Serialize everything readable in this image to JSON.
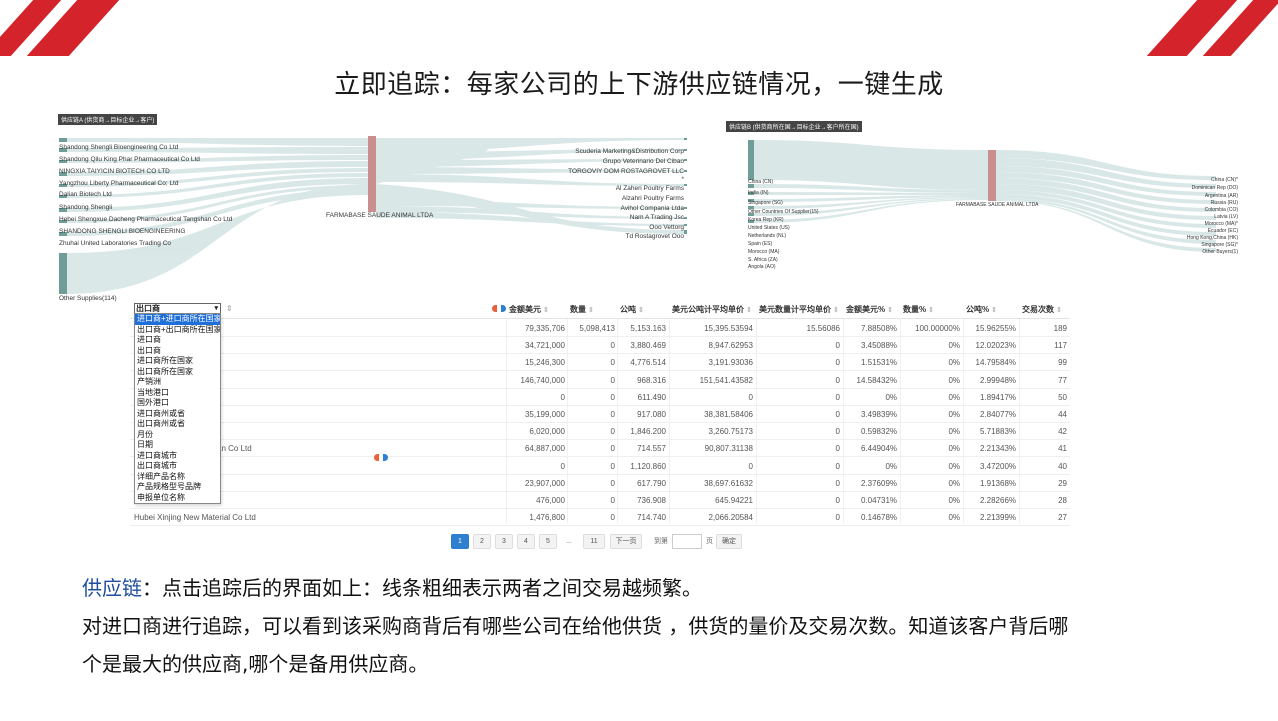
{
  "slide": {
    "title": "立即追踪：每家公司的上下游供应链情况，一键生成",
    "caption_keyword": "供应链",
    "caption_line1_rest": "：点击追踪后的界面如上：线条粗细表示两者之间交易越频繁。",
    "caption_line2": "对进口商进行追踪，可以看到该采购商背后有哪些公司在给他供货 ，供货的量价及交易次数。知道该客户背后哪",
    "caption_line3": "个是最大的供应商,哪个是备用供应商。",
    "accent_color": "#d4232b"
  },
  "sankey_left": {
    "label": "供应链A (供货商→目标企业→客户)",
    "center_node": "FARMABASE SAUDE ANIMAL LTDA",
    "suppliers": [
      "Shandong Shengli Bioengineering Co Ltd",
      "Shandong Qilu King Phar Pharmaceutical Co Ltd",
      "NINGXIA TAIYICIN BIOTECH CO LTD",
      "Yangzhou Liberty Pharmaceutical Co; Ltd",
      "Dalian Biotech Ltd",
      "Shandong Shengli",
      "Hebei Shengxue Dacheng Pharmaceutical Tangshan Co Ltd",
      "SHANDONG SHENGLI BIOENGINEERING",
      "Zhuhai United Laboratories Trading Co",
      "Other Supplies(114)"
    ],
    "customers": [
      "Scuderia Marketing&Distribution Corp",
      "Grupo Veterinario Del Cibao",
      "TORGOVIY DOM ROSTAGROVET LLC",
      "*",
      "Al Zaheri Poultry Farms",
      "Alzahri Poultry Farms",
      "Avihol Compania Ltda",
      "Nam A Trading Jsc",
      "Ooo Vettorg",
      "Td Rostagrovet Ooo"
    ]
  },
  "sankey_right": {
    "label": "供应链B (供货商所在国→目标企业→客户所在国)",
    "center_node": "FARMABASE SAUDE ANIMAL LTDA",
    "origins": [
      "China (CN)",
      "India (IN)",
      "Singapore (SG)",
      "Other Countries Of Supplier(15)",
      "Korea Rep (KR)",
      "United States (US)",
      "Netherlands (NL)",
      "Spain (ES)",
      "Morocco (MA)",
      "S. Africa (ZA)",
      "Angola (AO)"
    ],
    "destinations": [
      "China (CN)*",
      "Dominican Rep (DO)",
      "Argentina (AR)",
      "Russia (RU)",
      "Colombia (CO)",
      "Latvia (LV)",
      "Morocco (MA)*",
      "Ecuador (EC)",
      "Hong Kong,China (HK)",
      "Singapore (SG)*",
      "Other Buyers(1)"
    ]
  },
  "table": {
    "select_value": "出口商",
    "dropdown_options": [
      "进口商+进口商所在国家",
      "出口商+出口商所在国家",
      "进口商",
      "出口商",
      "进口商所在国家",
      "出口商所在国家",
      "产销洲",
      "当地港口",
      "国外港口",
      "进口商州或省",
      "出口商州或省",
      "月份",
      "日期",
      "进口商城市",
      "出口商城市",
      "详细产品名称",
      "产品规格型号品牌",
      "申报单位名称"
    ],
    "columns": [
      "金额美元",
      "数量",
      "公吨",
      "美元公吨计平均单价",
      "美元数量计平均单价",
      "金额美元%",
      "数量%",
      "公吨%",
      "交易次数"
    ],
    "rows": [
      {
        "name": "",
        "c": [
          "79,335,706",
          "5,098,413",
          "5,153.163",
          "15,395.53594",
          "15.56086",
          "7.88508%",
          "100.00000%",
          "15.96255%",
          "189"
        ]
      },
      {
        "name": "ineering Co Ltd",
        "c": [
          "34,721,000",
          "0",
          "3,880.469",
          "8,947.62953",
          "0",
          "3.45088%",
          "0%",
          "12.02023%",
          "117"
        ]
      },
      {
        "name": "Pharmaceutical Co Ltd",
        "c": [
          "15,246,300",
          "0",
          "4,776.514",
          "3,191.93036",
          "0",
          "1.51531%",
          "0%",
          "14.79584%",
          "99"
        ]
      },
      {
        "name": "H CO LTD",
        "c": [
          "146,740,000",
          "0",
          "968.316",
          "151,541.43582",
          "0",
          "14.58432%",
          "0%",
          "2.99948%",
          "77"
        ]
      },
      {
        "name": "eutical Co; Ltd",
        "c": [
          "0",
          "0",
          "611.490",
          "0",
          "0",
          "0%",
          "0%",
          "1.89417%",
          "50"
        ]
      },
      {
        "name": "",
        "c": [
          "35,199,000",
          "0",
          "917.080",
          "38,381.58406",
          "0",
          "3.49839%",
          "0%",
          "2.84077%",
          "44"
        ]
      },
      {
        "name": "",
        "c": [
          "6,020,000",
          "0",
          "1,846.200",
          "3,260.75173",
          "0",
          "0.59832%",
          "0%",
          "5.71883%",
          "42"
        ]
      },
      {
        "name": "Pharmaceutical Tangshan Co Ltd",
        "c": [
          "64,887,000",
          "0",
          "714.557",
          "90,807.31138",
          "0",
          "6.44904%",
          "0%",
          "2.21343%",
          "41"
        ]
      },
      {
        "name": "ENGINEERING",
        "c": [
          "0",
          "0",
          "1,120.860",
          "0",
          "0",
          "0%",
          "0%",
          "3.47200%",
          "40"
        ]
      },
      {
        "name": "s Trading Co",
        "c": [
          "23,907,000",
          "0",
          "617.790",
          "38,697.61632",
          "0",
          "2.37609%",
          "0%",
          "1.91368%",
          "29"
        ]
      },
      {
        "name": "s Co Ltd",
        "c": [
          "476,000",
          "0",
          "736.908",
          "645.94221",
          "0",
          "0.04731%",
          "0%",
          "2.28266%",
          "28"
        ]
      },
      {
        "name": "Hubei Xinjing New Material Co Ltd",
        "c": [
          "1,476,800",
          "0",
          "714.740",
          "2,066.20584",
          "0",
          "0.14678%",
          "0%",
          "2.21399%",
          "27"
        ]
      }
    ]
  },
  "pagination": {
    "pages": [
      "1",
      "2",
      "3",
      "4",
      "5"
    ],
    "ellipsis": "...",
    "last": "11",
    "next": "下一页",
    "goto_label": "到第",
    "page_label": "页",
    "confirm": "确定",
    "active": "1"
  }
}
